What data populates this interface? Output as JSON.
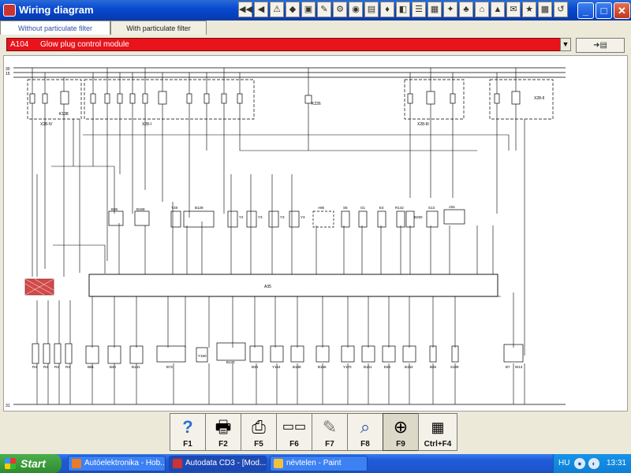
{
  "window": {
    "title": "Wiring diagram"
  },
  "toolbar": {
    "tools": [
      "◀◀",
      "◀",
      "⚠",
      "◆",
      "▣",
      "✎",
      "⚙",
      "◉",
      "▤",
      "♦",
      "◧",
      "☰",
      "▦",
      "✦",
      "♣",
      "⌂",
      "▲",
      "✉",
      "★",
      "▩",
      "↺"
    ],
    "window_buttons": [
      "_",
      "□",
      "✕"
    ]
  },
  "tabs": [
    {
      "label": "Without particulate filter",
      "active": true
    },
    {
      "label": "With particulate filter",
      "active": false
    }
  ],
  "module": {
    "code": "A104",
    "name": "Glow plug control module"
  },
  "diagram": {
    "labels": {
      "rail_30": "30",
      "rail_15": "15",
      "rail_31": "31",
      "ecu": "A35",
      "fuse_box_1": "X28-IV",
      "fuse_box_2": "X28-I",
      "fuse_box_3": "X28-III",
      "fuse_box_4": "X28-II",
      "relay_1": "K138",
      "relay_2": "K226"
    },
    "top_components": [
      "B38",
      "B168",
      "Y28",
      "B128",
      "Y2",
      "Y3",
      "Y3",
      "Y3",
      "A95",
      "S5",
      "G1",
      "E4",
      "R142",
      "B250",
      "S13",
      "A51"
    ],
    "bottom_components": [
      "R4",
      "R4",
      "R4",
      "R4",
      "B81",
      "B40",
      "B131",
      "B72",
      "Y150",
      "B130",
      "B34",
      "Y154",
      "B188",
      "B166",
      "Y170",
      "B161",
      "E64",
      "B152",
      "B26",
      "S189",
      "B7",
      "W13"
    ]
  },
  "fkeys": [
    {
      "label": "F1",
      "icon": "help-icon"
    },
    {
      "label": "F2",
      "icon": "print-preview-icon"
    },
    {
      "label": "F5",
      "icon": "printer-icon"
    },
    {
      "label": "F6",
      "icon": "component-icon"
    },
    {
      "label": "F7",
      "icon": "pen-icon"
    },
    {
      "label": "F8",
      "icon": "zoom-search-icon"
    },
    {
      "label": "F9",
      "icon": "zoom-pan-icon",
      "active": true
    },
    {
      "label": "Ctrl+F4",
      "icon": "grid-icon"
    }
  ],
  "taskbar": {
    "start": "Start",
    "tasks": [
      {
        "label": "Autóelektronika - Hob..."
      },
      {
        "label": "Autodata CD3 - [Mod..."
      },
      {
        "label": "névtelen - Paint"
      }
    ],
    "lang": "HU",
    "clock": "13:31"
  }
}
